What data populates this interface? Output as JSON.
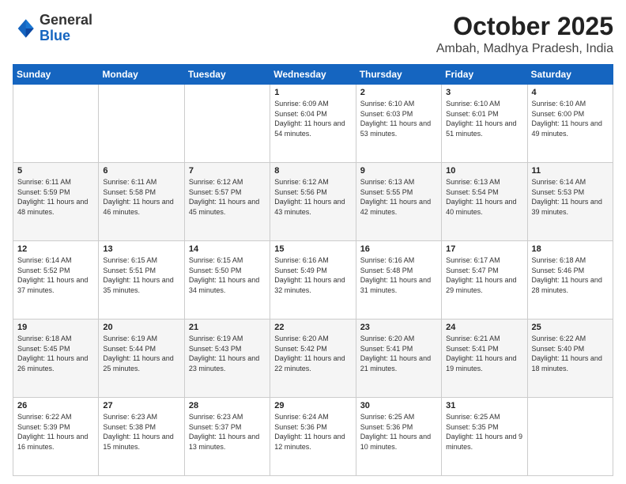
{
  "logo": {
    "general": "General",
    "blue": "Blue"
  },
  "header": {
    "month": "October 2025",
    "location": "Ambah, Madhya Pradesh, India"
  },
  "weekdays": [
    "Sunday",
    "Monday",
    "Tuesday",
    "Wednesday",
    "Thursday",
    "Friday",
    "Saturday"
  ],
  "weeks": [
    [
      {
        "day": "",
        "sunrise": "",
        "sunset": "",
        "daylight": ""
      },
      {
        "day": "",
        "sunrise": "",
        "sunset": "",
        "daylight": ""
      },
      {
        "day": "",
        "sunrise": "",
        "sunset": "",
        "daylight": ""
      },
      {
        "day": "1",
        "sunrise": "Sunrise: 6:09 AM",
        "sunset": "Sunset: 6:04 PM",
        "daylight": "Daylight: 11 hours and 54 minutes."
      },
      {
        "day": "2",
        "sunrise": "Sunrise: 6:10 AM",
        "sunset": "Sunset: 6:03 PM",
        "daylight": "Daylight: 11 hours and 53 minutes."
      },
      {
        "day": "3",
        "sunrise": "Sunrise: 6:10 AM",
        "sunset": "Sunset: 6:01 PM",
        "daylight": "Daylight: 11 hours and 51 minutes."
      },
      {
        "day": "4",
        "sunrise": "Sunrise: 6:10 AM",
        "sunset": "Sunset: 6:00 PM",
        "daylight": "Daylight: 11 hours and 49 minutes."
      }
    ],
    [
      {
        "day": "5",
        "sunrise": "Sunrise: 6:11 AM",
        "sunset": "Sunset: 5:59 PM",
        "daylight": "Daylight: 11 hours and 48 minutes."
      },
      {
        "day": "6",
        "sunrise": "Sunrise: 6:11 AM",
        "sunset": "Sunset: 5:58 PM",
        "daylight": "Daylight: 11 hours and 46 minutes."
      },
      {
        "day": "7",
        "sunrise": "Sunrise: 6:12 AM",
        "sunset": "Sunset: 5:57 PM",
        "daylight": "Daylight: 11 hours and 45 minutes."
      },
      {
        "day": "8",
        "sunrise": "Sunrise: 6:12 AM",
        "sunset": "Sunset: 5:56 PM",
        "daylight": "Daylight: 11 hours and 43 minutes."
      },
      {
        "day": "9",
        "sunrise": "Sunrise: 6:13 AM",
        "sunset": "Sunset: 5:55 PM",
        "daylight": "Daylight: 11 hours and 42 minutes."
      },
      {
        "day": "10",
        "sunrise": "Sunrise: 6:13 AM",
        "sunset": "Sunset: 5:54 PM",
        "daylight": "Daylight: 11 hours and 40 minutes."
      },
      {
        "day": "11",
        "sunrise": "Sunrise: 6:14 AM",
        "sunset": "Sunset: 5:53 PM",
        "daylight": "Daylight: 11 hours and 39 minutes."
      }
    ],
    [
      {
        "day": "12",
        "sunrise": "Sunrise: 6:14 AM",
        "sunset": "Sunset: 5:52 PM",
        "daylight": "Daylight: 11 hours and 37 minutes."
      },
      {
        "day": "13",
        "sunrise": "Sunrise: 6:15 AM",
        "sunset": "Sunset: 5:51 PM",
        "daylight": "Daylight: 11 hours and 35 minutes."
      },
      {
        "day": "14",
        "sunrise": "Sunrise: 6:15 AM",
        "sunset": "Sunset: 5:50 PM",
        "daylight": "Daylight: 11 hours and 34 minutes."
      },
      {
        "day": "15",
        "sunrise": "Sunrise: 6:16 AM",
        "sunset": "Sunset: 5:49 PM",
        "daylight": "Daylight: 11 hours and 32 minutes."
      },
      {
        "day": "16",
        "sunrise": "Sunrise: 6:16 AM",
        "sunset": "Sunset: 5:48 PM",
        "daylight": "Daylight: 11 hours and 31 minutes."
      },
      {
        "day": "17",
        "sunrise": "Sunrise: 6:17 AM",
        "sunset": "Sunset: 5:47 PM",
        "daylight": "Daylight: 11 hours and 29 minutes."
      },
      {
        "day": "18",
        "sunrise": "Sunrise: 6:18 AM",
        "sunset": "Sunset: 5:46 PM",
        "daylight": "Daylight: 11 hours and 28 minutes."
      }
    ],
    [
      {
        "day": "19",
        "sunrise": "Sunrise: 6:18 AM",
        "sunset": "Sunset: 5:45 PM",
        "daylight": "Daylight: 11 hours and 26 minutes."
      },
      {
        "day": "20",
        "sunrise": "Sunrise: 6:19 AM",
        "sunset": "Sunset: 5:44 PM",
        "daylight": "Daylight: 11 hours and 25 minutes."
      },
      {
        "day": "21",
        "sunrise": "Sunrise: 6:19 AM",
        "sunset": "Sunset: 5:43 PM",
        "daylight": "Daylight: 11 hours and 23 minutes."
      },
      {
        "day": "22",
        "sunrise": "Sunrise: 6:20 AM",
        "sunset": "Sunset: 5:42 PM",
        "daylight": "Daylight: 11 hours and 22 minutes."
      },
      {
        "day": "23",
        "sunrise": "Sunrise: 6:20 AM",
        "sunset": "Sunset: 5:41 PM",
        "daylight": "Daylight: 11 hours and 21 minutes."
      },
      {
        "day": "24",
        "sunrise": "Sunrise: 6:21 AM",
        "sunset": "Sunset: 5:41 PM",
        "daylight": "Daylight: 11 hours and 19 minutes."
      },
      {
        "day": "25",
        "sunrise": "Sunrise: 6:22 AM",
        "sunset": "Sunset: 5:40 PM",
        "daylight": "Daylight: 11 hours and 18 minutes."
      }
    ],
    [
      {
        "day": "26",
        "sunrise": "Sunrise: 6:22 AM",
        "sunset": "Sunset: 5:39 PM",
        "daylight": "Daylight: 11 hours and 16 minutes."
      },
      {
        "day": "27",
        "sunrise": "Sunrise: 6:23 AM",
        "sunset": "Sunset: 5:38 PM",
        "daylight": "Daylight: 11 hours and 15 minutes."
      },
      {
        "day": "28",
        "sunrise": "Sunrise: 6:23 AM",
        "sunset": "Sunset: 5:37 PM",
        "daylight": "Daylight: 11 hours and 13 minutes."
      },
      {
        "day": "29",
        "sunrise": "Sunrise: 6:24 AM",
        "sunset": "Sunset: 5:36 PM",
        "daylight": "Daylight: 11 hours and 12 minutes."
      },
      {
        "day": "30",
        "sunrise": "Sunrise: 6:25 AM",
        "sunset": "Sunset: 5:36 PM",
        "daylight": "Daylight: 11 hours and 10 minutes."
      },
      {
        "day": "31",
        "sunrise": "Sunrise: 6:25 AM",
        "sunset": "Sunset: 5:35 PM",
        "daylight": "Daylight: 11 hours and 9 minutes."
      },
      {
        "day": "",
        "sunrise": "",
        "sunset": "",
        "daylight": ""
      }
    ]
  ]
}
